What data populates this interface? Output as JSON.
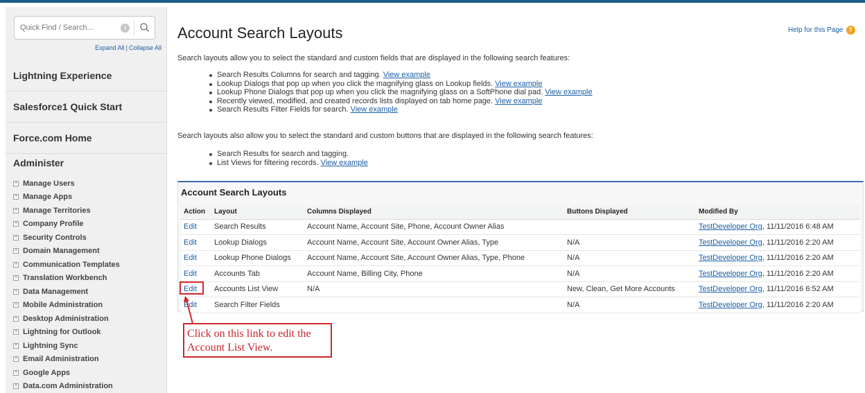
{
  "sidebar": {
    "search_placeholder": "Quick Find / Search...",
    "expand_all": "Expand All",
    "collapse_all": "Collapse All",
    "sections": [
      "Lightning Experience",
      "Salesforce1 Quick Start",
      "Force.com Home"
    ],
    "administer_title": "Administer",
    "admin_items": [
      "Manage Users",
      "Manage Apps",
      "Manage Territories",
      "Company Profile",
      "Security Controls",
      "Domain Management",
      "Communication Templates",
      "Translation Workbench",
      "Data Management",
      "Mobile Administration",
      "Desktop Administration",
      "Lightning for Outlook",
      "Lightning Sync",
      "Email Administration",
      "Google Apps",
      "Data.com Administration"
    ]
  },
  "header": {
    "title": "Account Search Layouts",
    "help_link": "Help for this Page"
  },
  "intro": {
    "para1": "Search layouts allow you to select the standard and custom fields that are displayed in the following search features:",
    "bullets1": [
      {
        "text": "Search Results Columns for search and tagging.",
        "link": "View example"
      },
      {
        "text": "Lookup Dialogs that pop up when you click the magnifying glass on Lookup fields.",
        "link": "View example"
      },
      {
        "text": "Lookup Phone Dialogs that pop up when you click the magnifying glass on a SoftPhone dial pad.",
        "link": "View example"
      },
      {
        "text": "Recently viewed, modified, and created records lists displayed on tab home page.",
        "link": "View example"
      },
      {
        "text": "Search Results Filter Fields for search.",
        "link": "View example"
      }
    ],
    "para2": "Search layouts also allow you to select the standard and custom buttons that are displayed in the following search features:",
    "bullets2": [
      {
        "text": "Search Results for search and tagging.",
        "link": ""
      },
      {
        "text": "List Views for filtering records.",
        "link": "View example"
      }
    ]
  },
  "table": {
    "title": "Account Search Layouts",
    "headers": [
      "Action",
      "Layout",
      "Columns Displayed",
      "Buttons Displayed",
      "Modified By"
    ],
    "rows": [
      {
        "action": "Edit",
        "layout": "Search Results",
        "columns": "Account Name, Account Site, Phone, Account Owner Alias",
        "buttons": "",
        "modified_by": "TestDeveloper Org",
        "modified_at": ", 11/11/2016 6:48 AM"
      },
      {
        "action": "Edit",
        "layout": "Lookup Dialogs",
        "columns": "Account Name, Account Site, Account Owner Alias, Type",
        "buttons": "N/A",
        "modified_by": "TestDeveloper Org",
        "modified_at": ", 11/11/2016 2:20 AM"
      },
      {
        "action": "Edit",
        "layout": "Lookup Phone Dialogs",
        "columns": "Account Name, Account Site, Account Owner Alias, Type, Phone",
        "buttons": "N/A",
        "modified_by": "TestDeveloper Org",
        "modified_at": ", 11/11/2016 2:20 AM"
      },
      {
        "action": "Edit",
        "layout": "Accounts Tab",
        "columns": "Account Name, Billing City, Phone",
        "buttons": "N/A",
        "modified_by": "TestDeveloper Org",
        "modified_at": ", 11/11/2016 2:20 AM"
      },
      {
        "action": "Edit",
        "layout": "Accounts List View",
        "columns": "N/A",
        "buttons": "New, Clean, Get More Accounts",
        "modified_by": "TestDeveloper Org",
        "modified_at": ", 11/11/2016 6:52 AM"
      },
      {
        "action": "Edit",
        "layout": "Search Filter Fields",
        "columns": "",
        "buttons": "N/A",
        "modified_by": "TestDeveloper Org",
        "modified_at": ", 11/11/2016 2:20 AM"
      }
    ]
  },
  "annotation": {
    "callout_text": "Click on this link to edit the Account List View.",
    "color": "#d1262a"
  },
  "colors": {
    "link": "#1a5ea5",
    "header_bar": "#1b5b8a",
    "help_icon": "#f0a21c"
  }
}
